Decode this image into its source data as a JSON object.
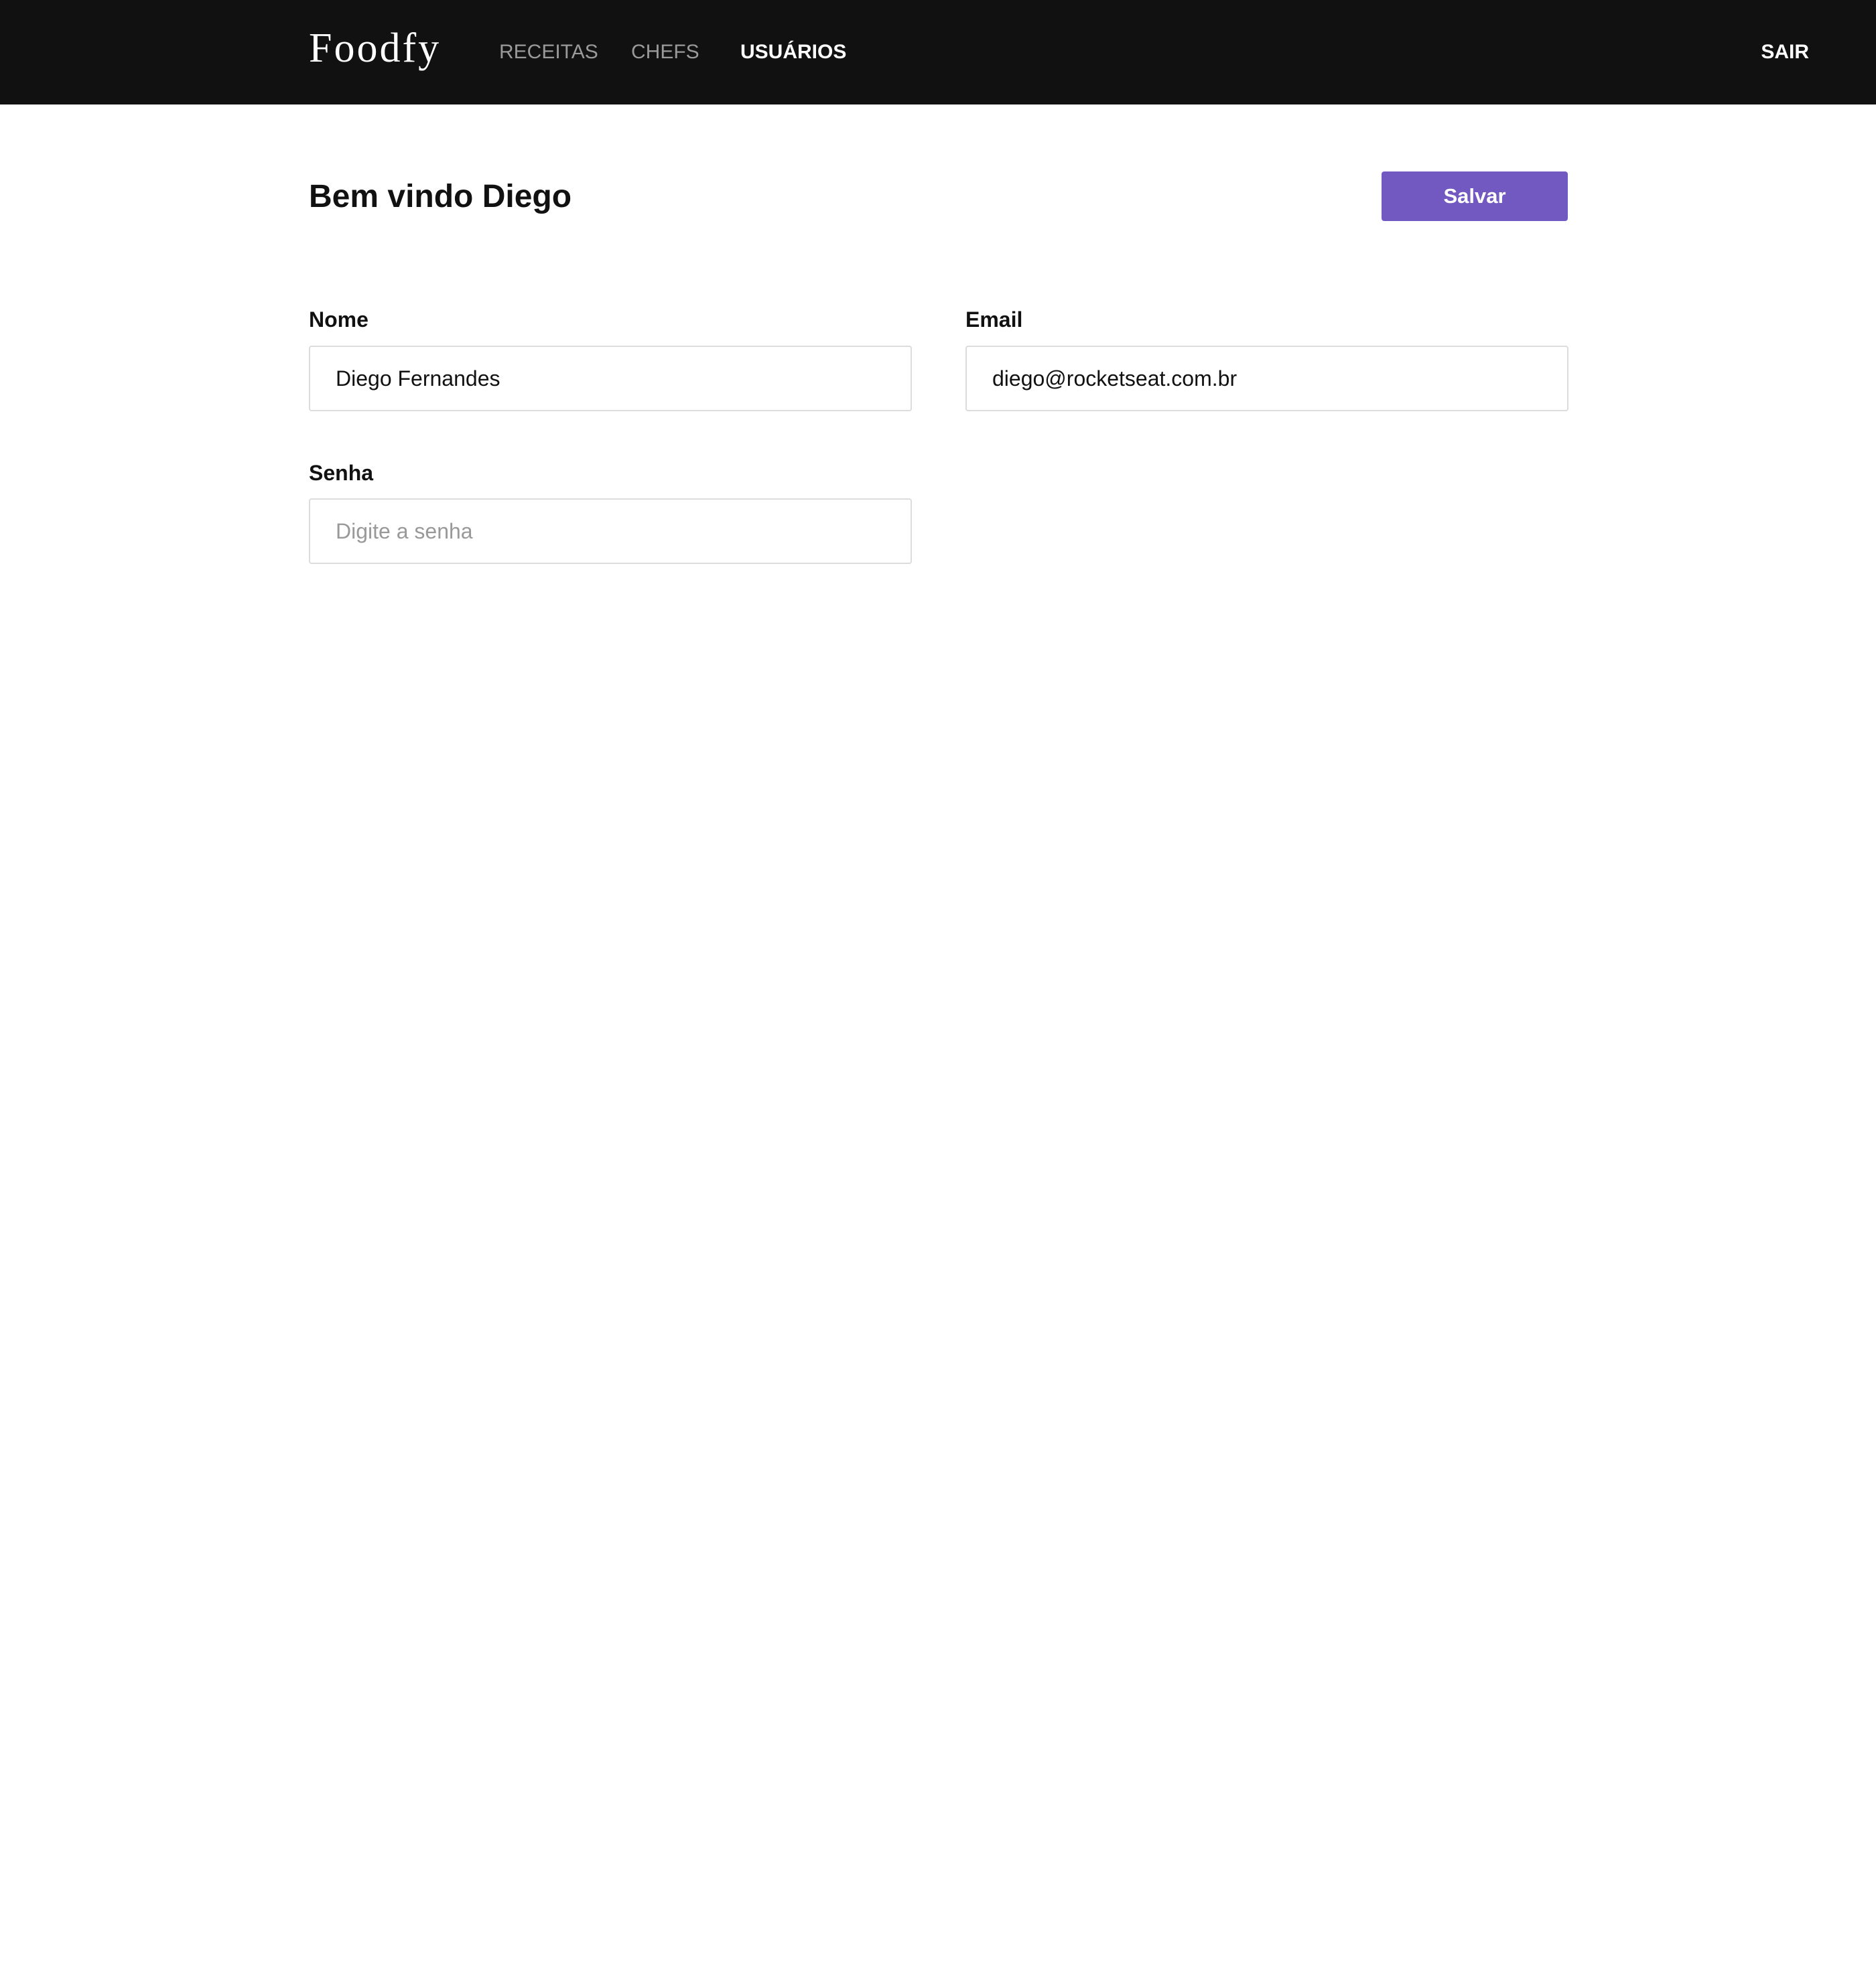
{
  "header": {
    "logo": "Foodfy",
    "nav": [
      {
        "label": "RECEITAS",
        "active": false
      },
      {
        "label": "CHEFS",
        "active": false
      },
      {
        "label": "USUÁRIOS",
        "active": true
      }
    ],
    "logout_label": "SAIR"
  },
  "main": {
    "title": "Bem vindo Diego",
    "save_label": "Salvar",
    "fields": {
      "name": {
        "label": "Nome",
        "value": "Diego Fernandes",
        "placeholder": ""
      },
      "email": {
        "label": "Email",
        "value": "diego@rocketseat.com.br",
        "placeholder": ""
      },
      "password": {
        "label": "Senha",
        "value": "",
        "placeholder": "Digite a senha"
      }
    }
  },
  "colors": {
    "header_bg": "#111111",
    "accent": "#7159c1",
    "nav_inactive": "#9a9a9a",
    "nav_active": "#ffffff",
    "input_border": "#dcdcdc"
  }
}
